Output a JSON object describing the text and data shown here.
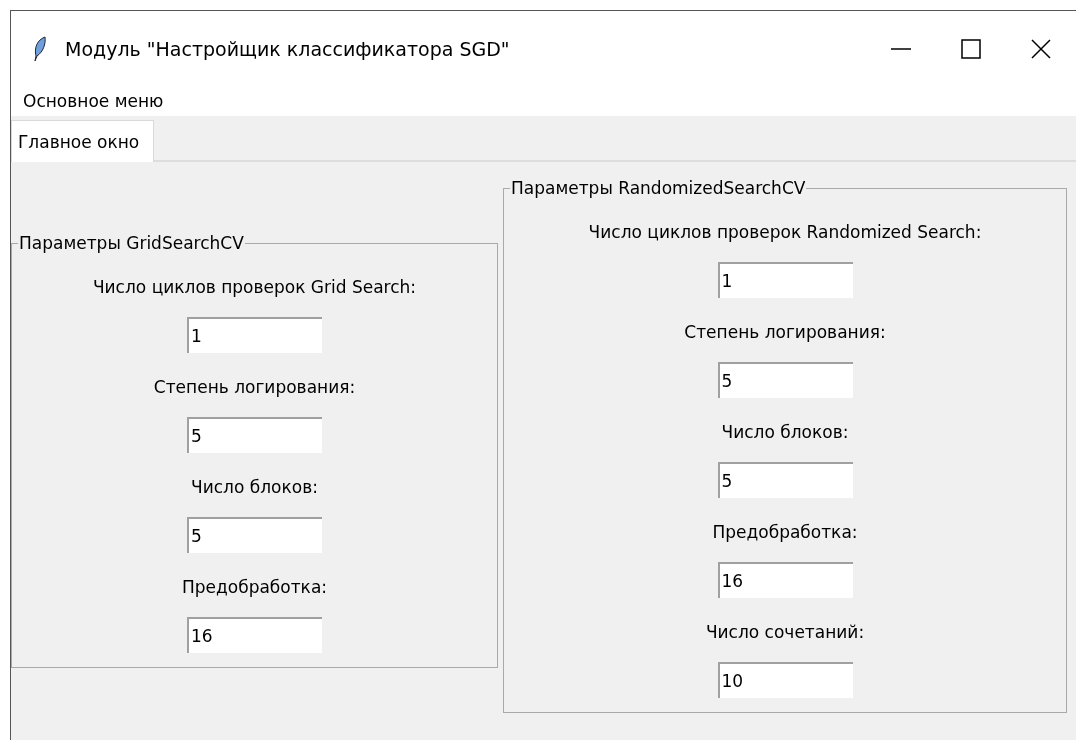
{
  "window": {
    "title": "Модуль \"Настройщик классификатора SGD\""
  },
  "menu": [
    "Основное меню"
  ],
  "tabs": [
    {
      "label": "Главное окно",
      "selected": true
    }
  ],
  "groups": [
    {
      "title": "Параметры GridSearchCV",
      "fields": [
        {
          "label": "Число циклов проверок Grid Search:",
          "value": "1"
        },
        {
          "label": "Степень логирования:",
          "value": "5"
        },
        {
          "label": "Число блоков:",
          "value": "5"
        },
        {
          "label": "Предобработка:",
          "value": "16"
        }
      ]
    },
    {
      "title": "Параметры RandomizedSearchCV",
      "fields": [
        {
          "label": "Число циклов проверок Randomized Search:",
          "value": "1"
        },
        {
          "label": "Степень логирования:",
          "value": "5"
        },
        {
          "label": "Число блоков:",
          "value": "5"
        },
        {
          "label": "Предобработка:",
          "value": "16"
        },
        {
          "label": "Число сочетаний:",
          "value": "10"
        }
      ]
    }
  ]
}
